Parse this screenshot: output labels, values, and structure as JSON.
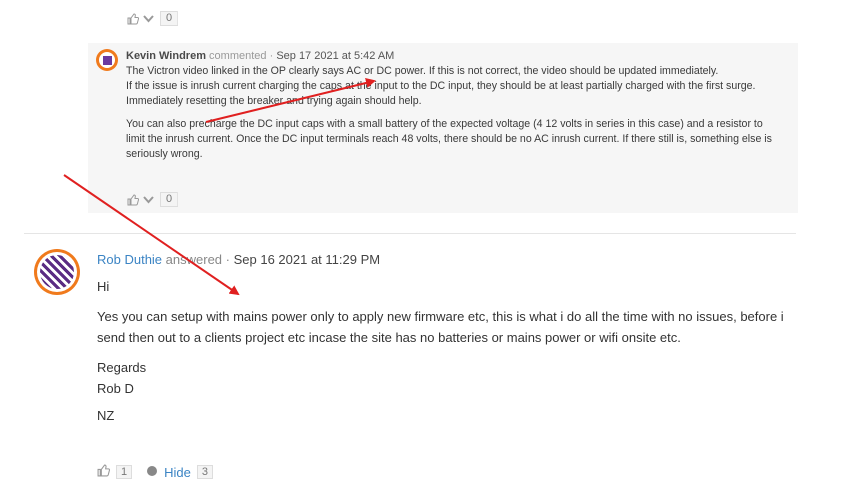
{
  "top_votes": {
    "count": "0"
  },
  "comment": {
    "author": "Kevin Windrem",
    "verb": "commented",
    "separator": " · ",
    "date": "Sep 17 2021 at 5:42 AM",
    "paragraphs": [
      "The Victron video linked in the OP clearly says AC or DC power. If this is not correct, the video should be updated immediately.",
      "If the issue is inrush current charging the caps at the input to the DC input, they should be at least partially charged with the first surge. Immediately resetting the breaker and trying again should help.",
      "You can also precharge the DC input caps with a small battery of the expected voltage (4 12 volts in series in this case) and a resistor to limit the inrush current. Once the DC input terminals reach 48 volts, there should be no AC inrush current. If there still is, something else is seriously wrong."
    ],
    "votes": "0"
  },
  "answer": {
    "author": "Rob Duthie",
    "verb": "answered",
    "separator": " · ",
    "date": "Sep 16 2021 at 11:29 PM",
    "paragraphs": [
      "Hi",
      "Yes you can setup with mains power only to apply new firmware etc, this is what i do all the time with no issues, before i send then out to a clients project etc incase the site has no batteries or mains power or wifi onsite etc.",
      "Regards",
      "Rob D",
      "NZ"
    ],
    "likes": "1",
    "hide_label": "Hide",
    "hide_count": "3"
  },
  "annotation_color": "#e02020",
  "brand_orange": "#f07a1c",
  "link_blue": "#3b84c4"
}
